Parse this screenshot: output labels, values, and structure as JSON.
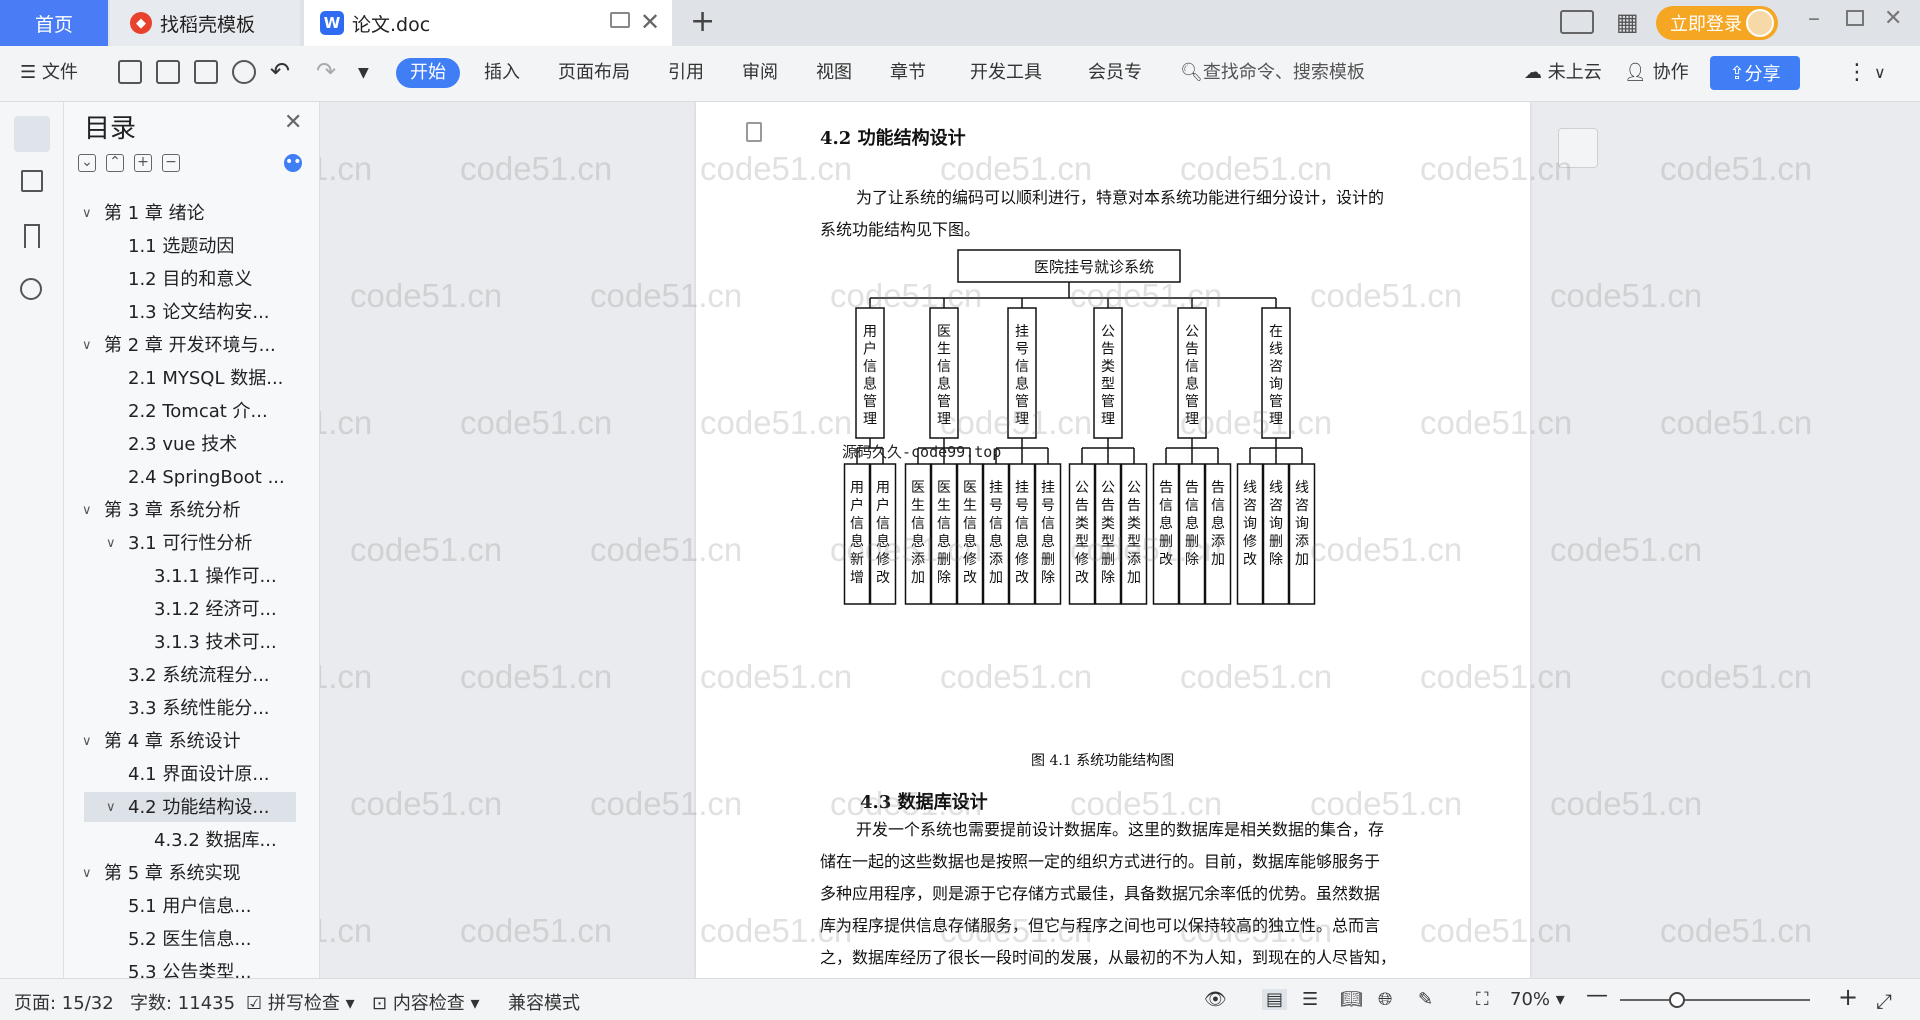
{
  "tabs": {
    "home": "首页",
    "templates": "找稻壳模板",
    "document": "论文.doc"
  },
  "titlebar": {
    "login": "立即登录"
  },
  "toolbar": {
    "file": "文件",
    "menus": [
      "开始",
      "插入",
      "页面布局",
      "引用",
      "审阅",
      "视图",
      "章节",
      "开发工具",
      "会员专"
    ],
    "search_placeholder": "查找命令、搜索模板",
    "cloud": "未上云",
    "collab": "协作",
    "share": "分享"
  },
  "toc": {
    "title": "目录",
    "items": [
      {
        "level": 1,
        "text": "第 1 章  绪论",
        "expand": "down"
      },
      {
        "level": 2,
        "text": "1.1 选题动因"
      },
      {
        "level": 2,
        "text": "1.2 目的和意义"
      },
      {
        "level": 2,
        "text": "1.3 论文结构安..."
      },
      {
        "level": 1,
        "text": "第 2 章  开发环境与...",
        "expand": "down"
      },
      {
        "level": 2,
        "text": "2.1 MYSQL 数据..."
      },
      {
        "level": 2,
        "text": "2.2 Tomcat  介..."
      },
      {
        "level": 2,
        "text": "2.3 vue 技术"
      },
      {
        "level": 2,
        "text": "2.4 SpringBoot ..."
      },
      {
        "level": 1,
        "text": "第 3 章  系统分析",
        "expand": "down"
      },
      {
        "level": 2,
        "text": "3.1 可行性分析",
        "expand": "down"
      },
      {
        "level": 3,
        "text": "3.1.1 操作可..."
      },
      {
        "level": 3,
        "text": "3.1.2 经济可..."
      },
      {
        "level": 3,
        "text": "3.1.3 技术可..."
      },
      {
        "level": 2,
        "text": "3.2 系统流程分..."
      },
      {
        "level": 2,
        "text": "3.3 系统性能分..."
      },
      {
        "level": 1,
        "text": "第 4 章  系统设计",
        "expand": "down"
      },
      {
        "level": 2,
        "text": "4.1 界面设计原..."
      },
      {
        "level": 2,
        "text": "4.2 功能结构设...",
        "expand": "down",
        "active": true
      },
      {
        "level": 3,
        "text": "4.3.2  数据库..."
      },
      {
        "level": 1,
        "text": "第 5 章  系统实现",
        "expand": "down"
      },
      {
        "level": 2,
        "text": "5.1 用户信息..."
      },
      {
        "level": 2,
        "text": "5.2  医生信息..."
      },
      {
        "level": 2,
        "text": "5.3 公告类型..."
      }
    ]
  },
  "doc": {
    "heading1": "4.2 功能结构设计",
    "para1_l1": "为了让系统的编码可以顺利进行，特意对本系统功能进行细分设计，设计的",
    "para1_l2": "系统功能结构见下图。",
    "figure_caption": "图 4.1  系统功能结构图",
    "heading2": "4.3  数据库设计",
    "para2": [
      "开发一个系统也需要提前设计数据库。这里的数据库是相关数据的集合，存",
      "储在一起的这些数据也是按照一定的组织方式进行的。目前，数据库能够服务于",
      "多种应用程序，则是源于它存储方式最佳，具备数据冗余率低的优势。虽然数据",
      "库为程序提供信息存储服务，但它与程序之间也可以保持较高的独立性。总而言",
      "之，数据库经历了很长一段时间的发展，从最初的不为人知，到现在的人尽皆知，"
    ],
    "overlay_text": "源码久久-code99.top",
    "diagram": {
      "root": "医院挂号就诊系统",
      "modules": [
        {
          "name": "用户信息管理",
          "leaves": [
            "用户信息新增",
            "用户信息修改"
          ]
        },
        {
          "name": "医生信息管理",
          "leaves": [
            "医生信息添加",
            "医生信息删除",
            "医生信息修改"
          ]
        },
        {
          "name": "挂号信息管理",
          "leaves": [
            "挂号信息添加",
            "挂号信息修改",
            "挂号信息删除"
          ]
        },
        {
          "name": "公告类型管理",
          "leaves": [
            "公告类型修改",
            "公告类型删除",
            "公告类型添加"
          ]
        },
        {
          "name": "公告信息管理",
          "leaves": [
            "告信息删改",
            "告信息删除",
            "告信息添加"
          ]
        },
        {
          "name": "在线咨询管理",
          "leaves": [
            "线咨询修改",
            "线咨询删除",
            "线咨询添加"
          ]
        }
      ]
    }
  },
  "watermark": "code51.cn",
  "status": {
    "page": "页面: 15/32",
    "words": "字数: 11435",
    "spell": "拼写检查",
    "content": "内容检查",
    "compat": "兼容模式",
    "zoom": "70%",
    "zoom_value": 0.3
  }
}
